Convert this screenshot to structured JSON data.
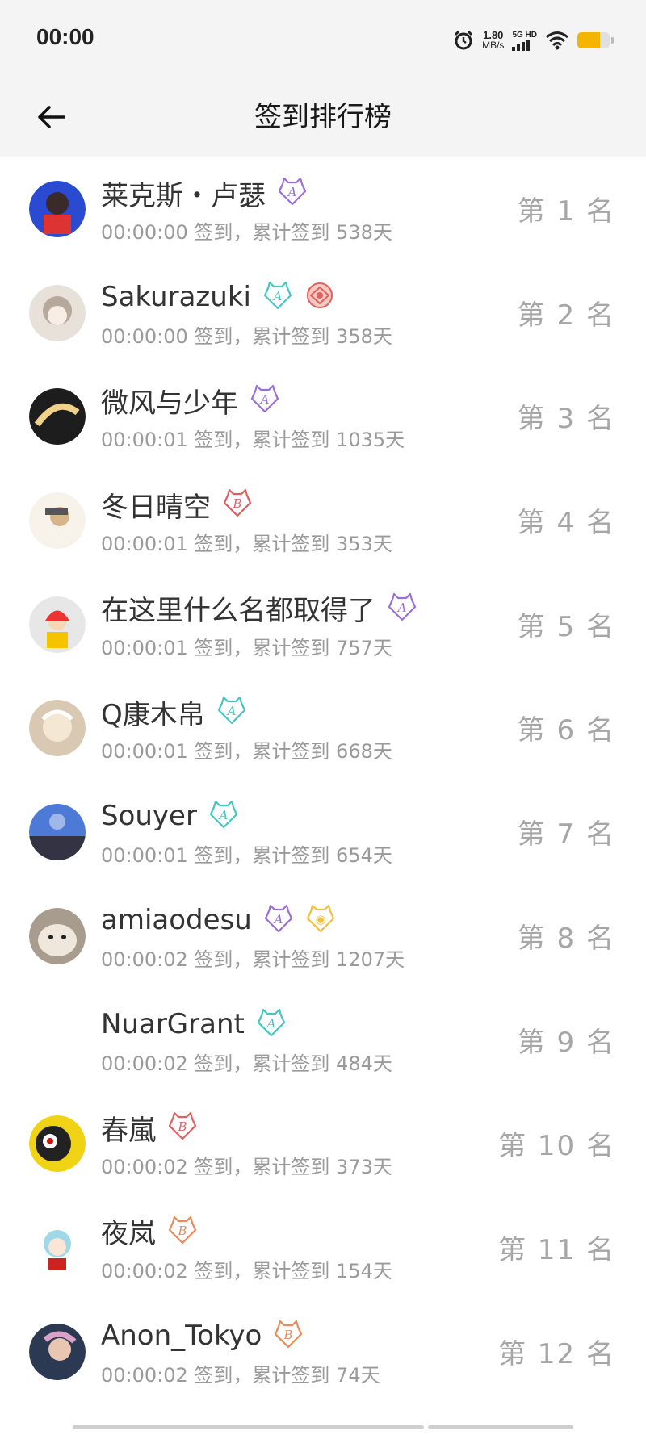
{
  "status_bar": {
    "time": "00:00",
    "net_speed_value": "1.80",
    "net_speed_unit": "MB/s",
    "network_type": "5G HD",
    "battery_level": 0.7,
    "battery_color": "#f5b400"
  },
  "header": {
    "title": "签到排行榜",
    "back_icon": "arrow-left-icon"
  },
  "colors": {
    "badge_purple": "#9b6fd8",
    "badge_teal": "#45c7c0",
    "badge_red": "#e06060",
    "badge_orange": "#e88a5a",
    "badge_gold": "#f0c040",
    "text_primary": "#333333",
    "text_secondary": "#9a9a9a",
    "header_bg": "#f4f4f4"
  },
  "rankings": [
    {
      "name": "莱克斯・卢瑟",
      "info": "00:00:00 签到，累计签到 538天",
      "rank": "第 1 名",
      "badges": [
        "purple"
      ]
    },
    {
      "name": "Sakurazuki",
      "info": "00:00:00 签到，累计签到 358天",
      "rank": "第 2 名",
      "badges": [
        "teal",
        "red-emblem"
      ]
    },
    {
      "name": "微风与少年",
      "info": "00:00:01 签到，累计签到 1035天",
      "rank": "第 3 名",
      "badges": [
        "purple"
      ]
    },
    {
      "name": "冬日晴空",
      "info": "00:00:01 签到，累计签到 353天",
      "rank": "第 4 名",
      "badges": [
        "red"
      ]
    },
    {
      "name": "在这里什么名都取得了",
      "info": "00:00:01 签到，累计签到 757天",
      "rank": "第 5 名",
      "badges": [
        "purple"
      ]
    },
    {
      "name": "Q康木帛",
      "info": "00:00:01 签到，累计签到 668天",
      "rank": "第 6 名",
      "badges": [
        "teal"
      ]
    },
    {
      "name": "Souyer",
      "info": "00:00:01 签到，累计签到 654天",
      "rank": "第 7 名",
      "badges": [
        "teal"
      ]
    },
    {
      "name": "amiaodesu",
      "info": "00:00:02 签到，累计签到 1207天",
      "rank": "第 8 名",
      "badges": [
        "purple",
        "gold"
      ]
    },
    {
      "name": "NuarGrant",
      "info": "00:00:02 签到，累计签到 484天",
      "rank": "第 9 名",
      "badges": [
        "teal"
      ]
    },
    {
      "name": "春嵐",
      "info": "00:00:02 签到，累计签到 373天",
      "rank": "第 10 名",
      "badges": [
        "red"
      ]
    },
    {
      "name": "夜岚",
      "info": "00:00:02 签到，累计签到 154天",
      "rank": "第 11 名",
      "badges": [
        "orange"
      ]
    },
    {
      "name": "Anon_Tokyo",
      "info": "00:00:02 签到，累计签到 74天",
      "rank": "第 12 名",
      "badges": [
        "orange"
      ]
    }
  ]
}
